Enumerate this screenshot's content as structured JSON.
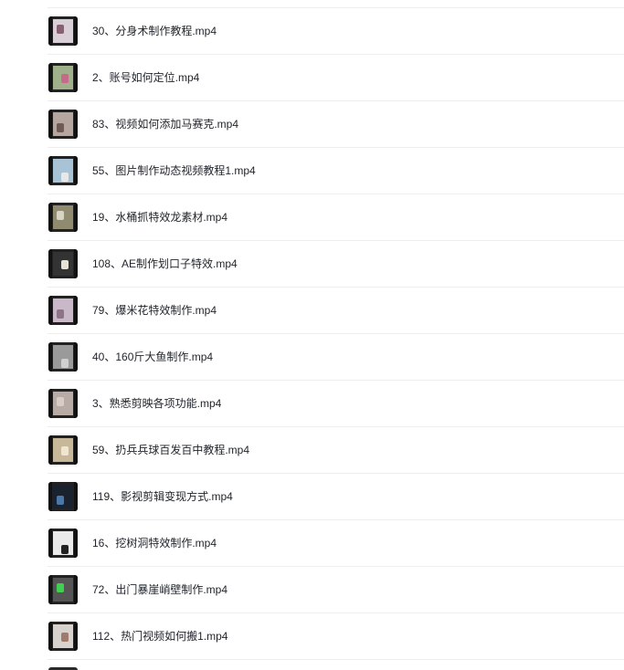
{
  "files": [
    {
      "name": "30、分身术制作教程.mp4",
      "thumb": {
        "bg": "#d9cfd6",
        "accent": "#8a5f74",
        "icon": "video-thumbnail-icon"
      }
    },
    {
      "name": "2、账号如何定位.mp4",
      "thumb": {
        "bg": "#9fb08a",
        "accent": "#c56a8a",
        "icon": "video-thumbnail-icon"
      }
    },
    {
      "name": "83、视频如何添加马赛克.mp4",
      "thumb": {
        "bg": "#b5a7a0",
        "accent": "#6f5b55",
        "icon": "video-thumbnail-icon"
      }
    },
    {
      "name": "55、图片制作动态视频教程1.mp4",
      "thumb": {
        "bg": "#a9c3d6",
        "accent": "#e8e8e8",
        "icon": "video-thumbnail-icon"
      }
    },
    {
      "name": "19、水桶抓特效龙素材.mp4",
      "thumb": {
        "bg": "#8f8a70",
        "accent": "#d8d4c4",
        "icon": "video-thumbnail-icon"
      }
    },
    {
      "name": "108、AE制作划口子特效.mp4",
      "thumb": {
        "bg": "#333333",
        "accent": "#e7e2d6",
        "icon": "video-thumbnail-icon"
      }
    },
    {
      "name": "79、爆米花特效制作.mp4",
      "thumb": {
        "bg": "#c9b9c8",
        "accent": "#8d7486",
        "icon": "video-thumbnail-icon"
      }
    },
    {
      "name": "40、160斤大鱼制作.mp4",
      "thumb": {
        "bg": "#9a9a9a",
        "accent": "#d0d0d0",
        "icon": "video-thumbnail-icon"
      }
    },
    {
      "name": "3、熟悉剪映各项功能.mp4",
      "thumb": {
        "bg": "#b8aaa4",
        "accent": "#d7cdc6",
        "icon": "video-thumbnail-icon"
      }
    },
    {
      "name": "59、扔兵兵球百发百中教程.mp4",
      "thumb": {
        "bg": "#c8b89a",
        "accent": "#f0e6d0",
        "icon": "video-thumbnail-icon"
      }
    },
    {
      "name": "119、影视剪辑变现方式.mp4",
      "thumb": {
        "bg": "#1a2230",
        "accent": "#4b78a8",
        "icon": "video-thumbnail-icon"
      }
    },
    {
      "name": "16、挖树洞特效制作.mp4",
      "thumb": {
        "bg": "#eaeaea",
        "accent": "#222222",
        "icon": "video-thumbnail-icon"
      }
    },
    {
      "name": "72、出门暴崖峭壁制作.mp4",
      "thumb": {
        "bg": "#555555",
        "accent": "#3ed04f",
        "icon": "video-thumbnail-icon"
      }
    },
    {
      "name": "112、热门视频如何搬1.mp4",
      "thumb": {
        "bg": "#d8d2cf",
        "accent": "#a07a6c",
        "icon": "video-thumbnail-icon"
      }
    }
  ]
}
